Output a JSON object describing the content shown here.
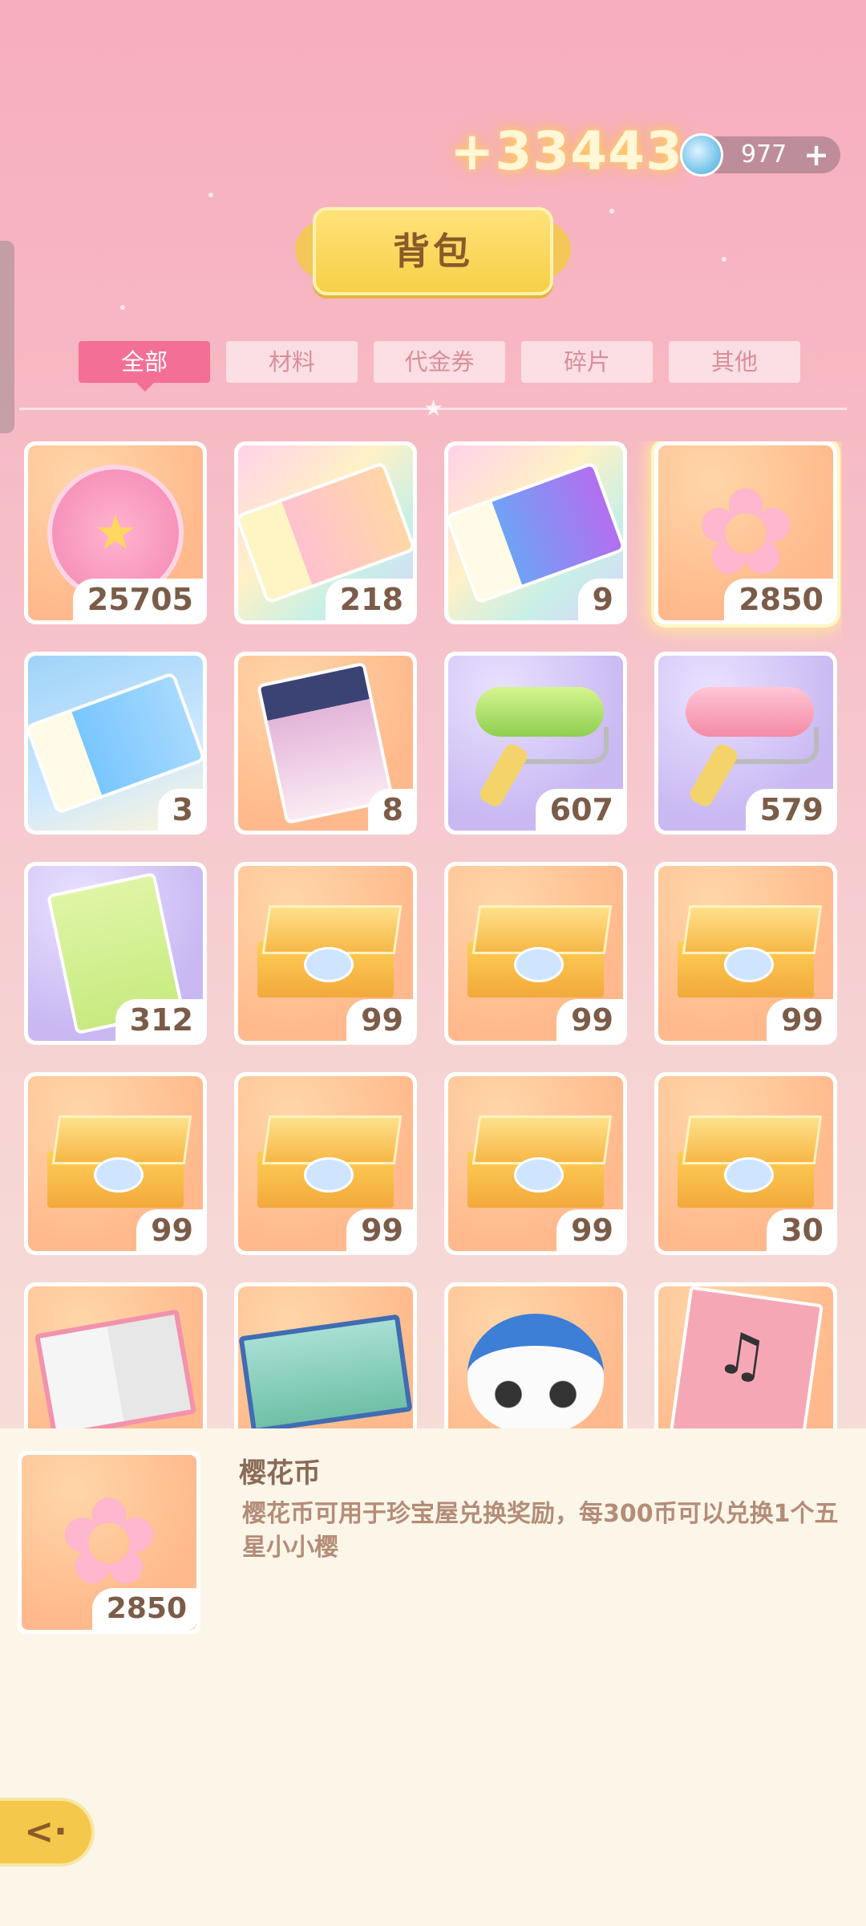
{
  "header": {
    "gain_text": "+33443",
    "currency_value": "977",
    "currency_add": "+",
    "title": "背包"
  },
  "tabs": [
    {
      "label": "全部",
      "active": true
    },
    {
      "label": "材料",
      "active": false
    },
    {
      "label": "代金券",
      "active": false
    },
    {
      "label": "碎片",
      "active": false
    },
    {
      "label": "其他",
      "active": false
    }
  ],
  "items": [
    {
      "icon": "bag-coin-icon",
      "count": "25705"
    },
    {
      "icon": "pink-ticket-icon",
      "count": "218"
    },
    {
      "icon": "mystery-ticket-icon",
      "count": "9"
    },
    {
      "icon": "sakura-coin-icon",
      "count": "2850",
      "selected": true
    },
    {
      "icon": "blue-ticket-icon",
      "count": "3"
    },
    {
      "icon": "bag-voucher-icon",
      "count": "8"
    },
    {
      "icon": "green-roller-icon",
      "count": "607"
    },
    {
      "icon": "pink-roller-icon",
      "count": "579"
    },
    {
      "icon": "green-voucher-icon",
      "count": "312"
    },
    {
      "icon": "puzzle-box-icon",
      "count": "99"
    },
    {
      "icon": "puzzle-box-icon",
      "count": "99"
    },
    {
      "icon": "puzzle-box-icon",
      "count": "99"
    },
    {
      "icon": "puzzle-box-icon",
      "count": "99"
    },
    {
      "icon": "puzzle-box-icon",
      "count": "99"
    },
    {
      "icon": "puzzle-box-icon",
      "count": "99"
    },
    {
      "icon": "puzzle-box-icon",
      "count": "30"
    },
    {
      "icon": "coloring-book-icon",
      "count": ""
    },
    {
      "icon": "bear-puzzle-icon",
      "count": ""
    },
    {
      "icon": "panda-plush-icon",
      "count": ""
    },
    {
      "icon": "music-book-icon",
      "count": ""
    }
  ],
  "detail": {
    "icon": "sakura-coin-icon",
    "count": "2850",
    "name": "樱花币",
    "description": "樱花币可用于珍宝屋兑换奖励，每300币可以兑换1个五星小小樱"
  },
  "back_button": {
    "icon": "back-arrow-icon",
    "label": "<·"
  }
}
